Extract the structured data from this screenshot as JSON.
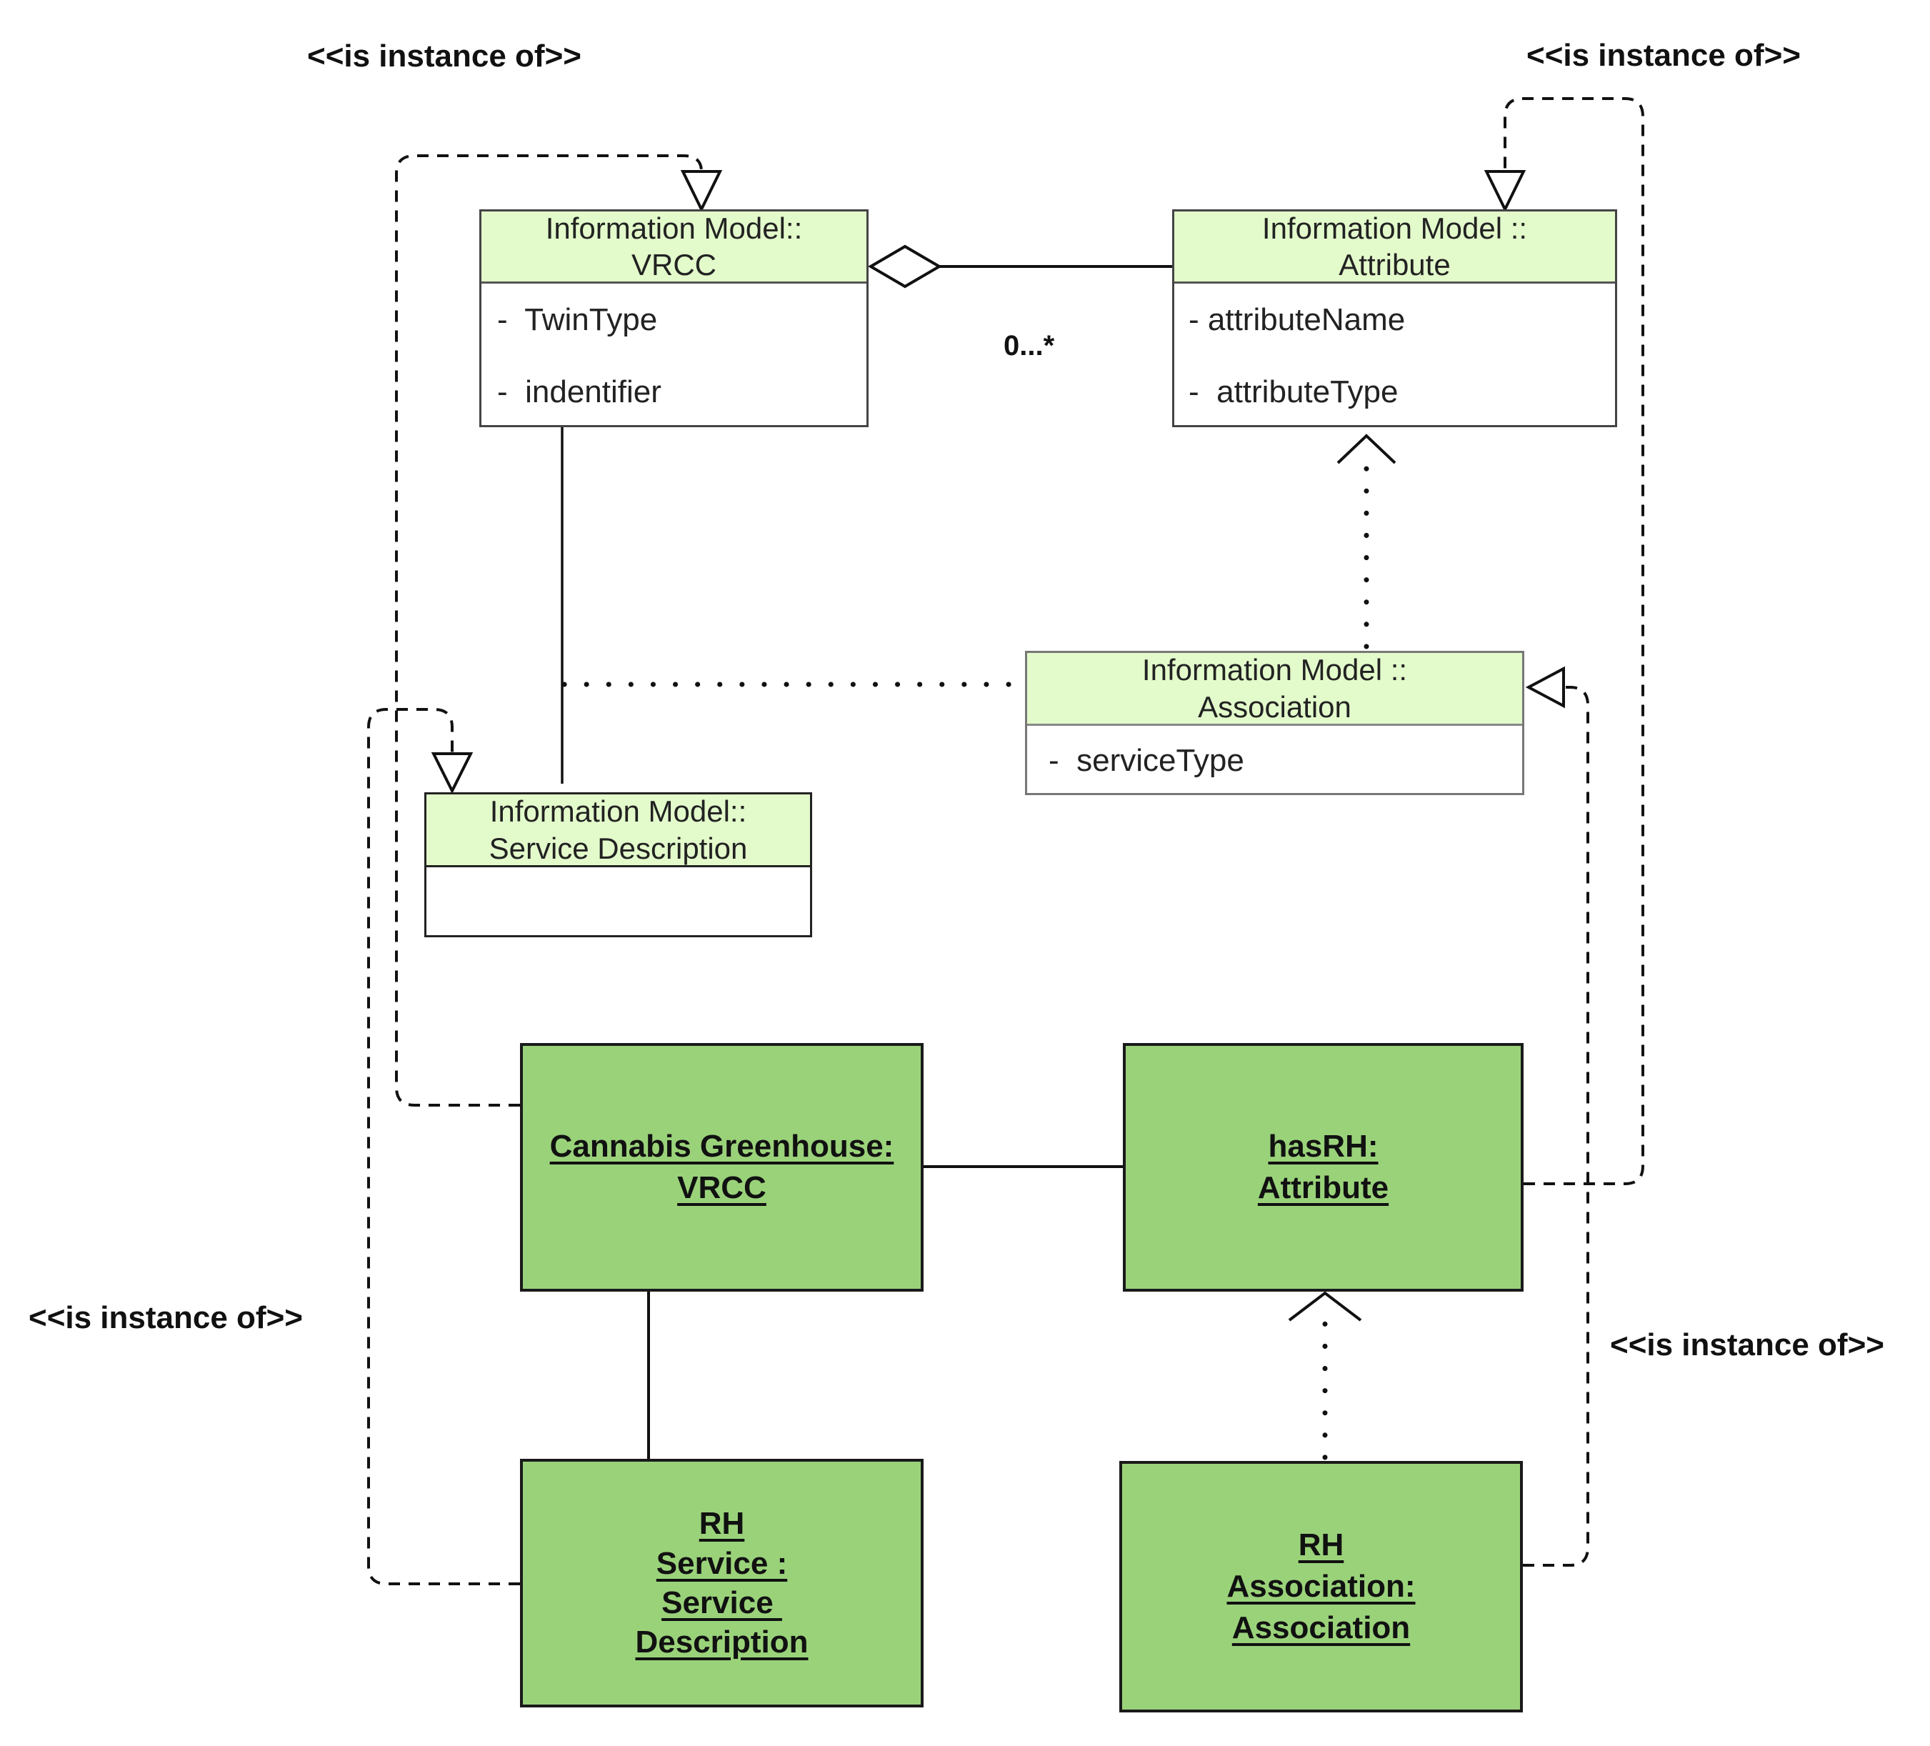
{
  "diagram": {
    "type": "UML class/object diagram",
    "stereotype_labels": [
      {
        "id": "top-left",
        "text": "<<is instance of>>"
      },
      {
        "id": "top-right",
        "text": "<<is instance of>>"
      },
      {
        "id": "bottom-left",
        "text": "<<is instance of>>"
      },
      {
        "id": "bottom-right",
        "text": "<<is instance of>>"
      }
    ],
    "classes": {
      "vrcc": {
        "title_line1": "Information Model::",
        "title_line2": "VRCC",
        "attributes": [
          "-  TwinType",
          "-  indentifier"
        ]
      },
      "attribute": {
        "title_line1": "Information Model ::",
        "title_line2": "Attribute",
        "attributes": [
          "- attributeName",
          "-  attributeType"
        ]
      },
      "association": {
        "title_line1": "Information Model ::",
        "title_line2": "Association",
        "attributes": [
          "-  serviceType"
        ]
      },
      "service_description": {
        "title_line1": "Information Model::",
        "title_line2": "Service Description",
        "attributes": []
      }
    },
    "instances": {
      "cannabis": {
        "lines": [
          "Cannabis Greenhouse:",
          "VRCC"
        ]
      },
      "hasrh": {
        "lines": [
          "hasRH:",
          "Attribute"
        ]
      },
      "rh_service": {
        "lines": [
          "RH",
          "Service :",
          "Service ",
          "Description"
        ]
      },
      "rh_association": {
        "lines": [
          "RH",
          "Association:",
          "Association"
        ]
      }
    },
    "multiplicity": "0...*",
    "relationships": [
      {
        "from": "Information Model::VRCC",
        "to": "Information Model::Attribute",
        "kind": "aggregation",
        "multiplicity": "0...*"
      },
      {
        "from": "Information Model::VRCC",
        "to": "Information Model::Service Description",
        "kind": "association"
      },
      {
        "from": "Information Model::Association",
        "to": "VRCC–Service Description link",
        "kind": "association class (dotted)"
      },
      {
        "from": "Information Model::Association",
        "to": "Information Model::Attribute",
        "kind": "dependency"
      },
      {
        "from": "Cannabis Greenhouse: VRCC",
        "to": "hasRH: Attribute",
        "kind": "link"
      },
      {
        "from": "Cannabis Greenhouse: VRCC",
        "to": "RH Service : Service Description",
        "kind": "link"
      },
      {
        "from": "RH Association: Association",
        "to": "hasRH: Attribute",
        "kind": "dependency"
      },
      {
        "from": "Cannabis Greenhouse: VRCC",
        "to": "Information Model::VRCC",
        "kind": "is instance of"
      },
      {
        "from": "hasRH: Attribute",
        "to": "Information Model::Attribute",
        "kind": "is instance of"
      },
      {
        "from": "RH Service : Service Description",
        "to": "Information Model::Service Description",
        "kind": "is instance of"
      },
      {
        "from": "RH Association: Association",
        "to": "Information Model::Association",
        "kind": "is instance of"
      }
    ],
    "colors": {
      "class_header": "#e3fbcb",
      "instance_fill": "#9ad27a",
      "line": "#111111"
    }
  }
}
